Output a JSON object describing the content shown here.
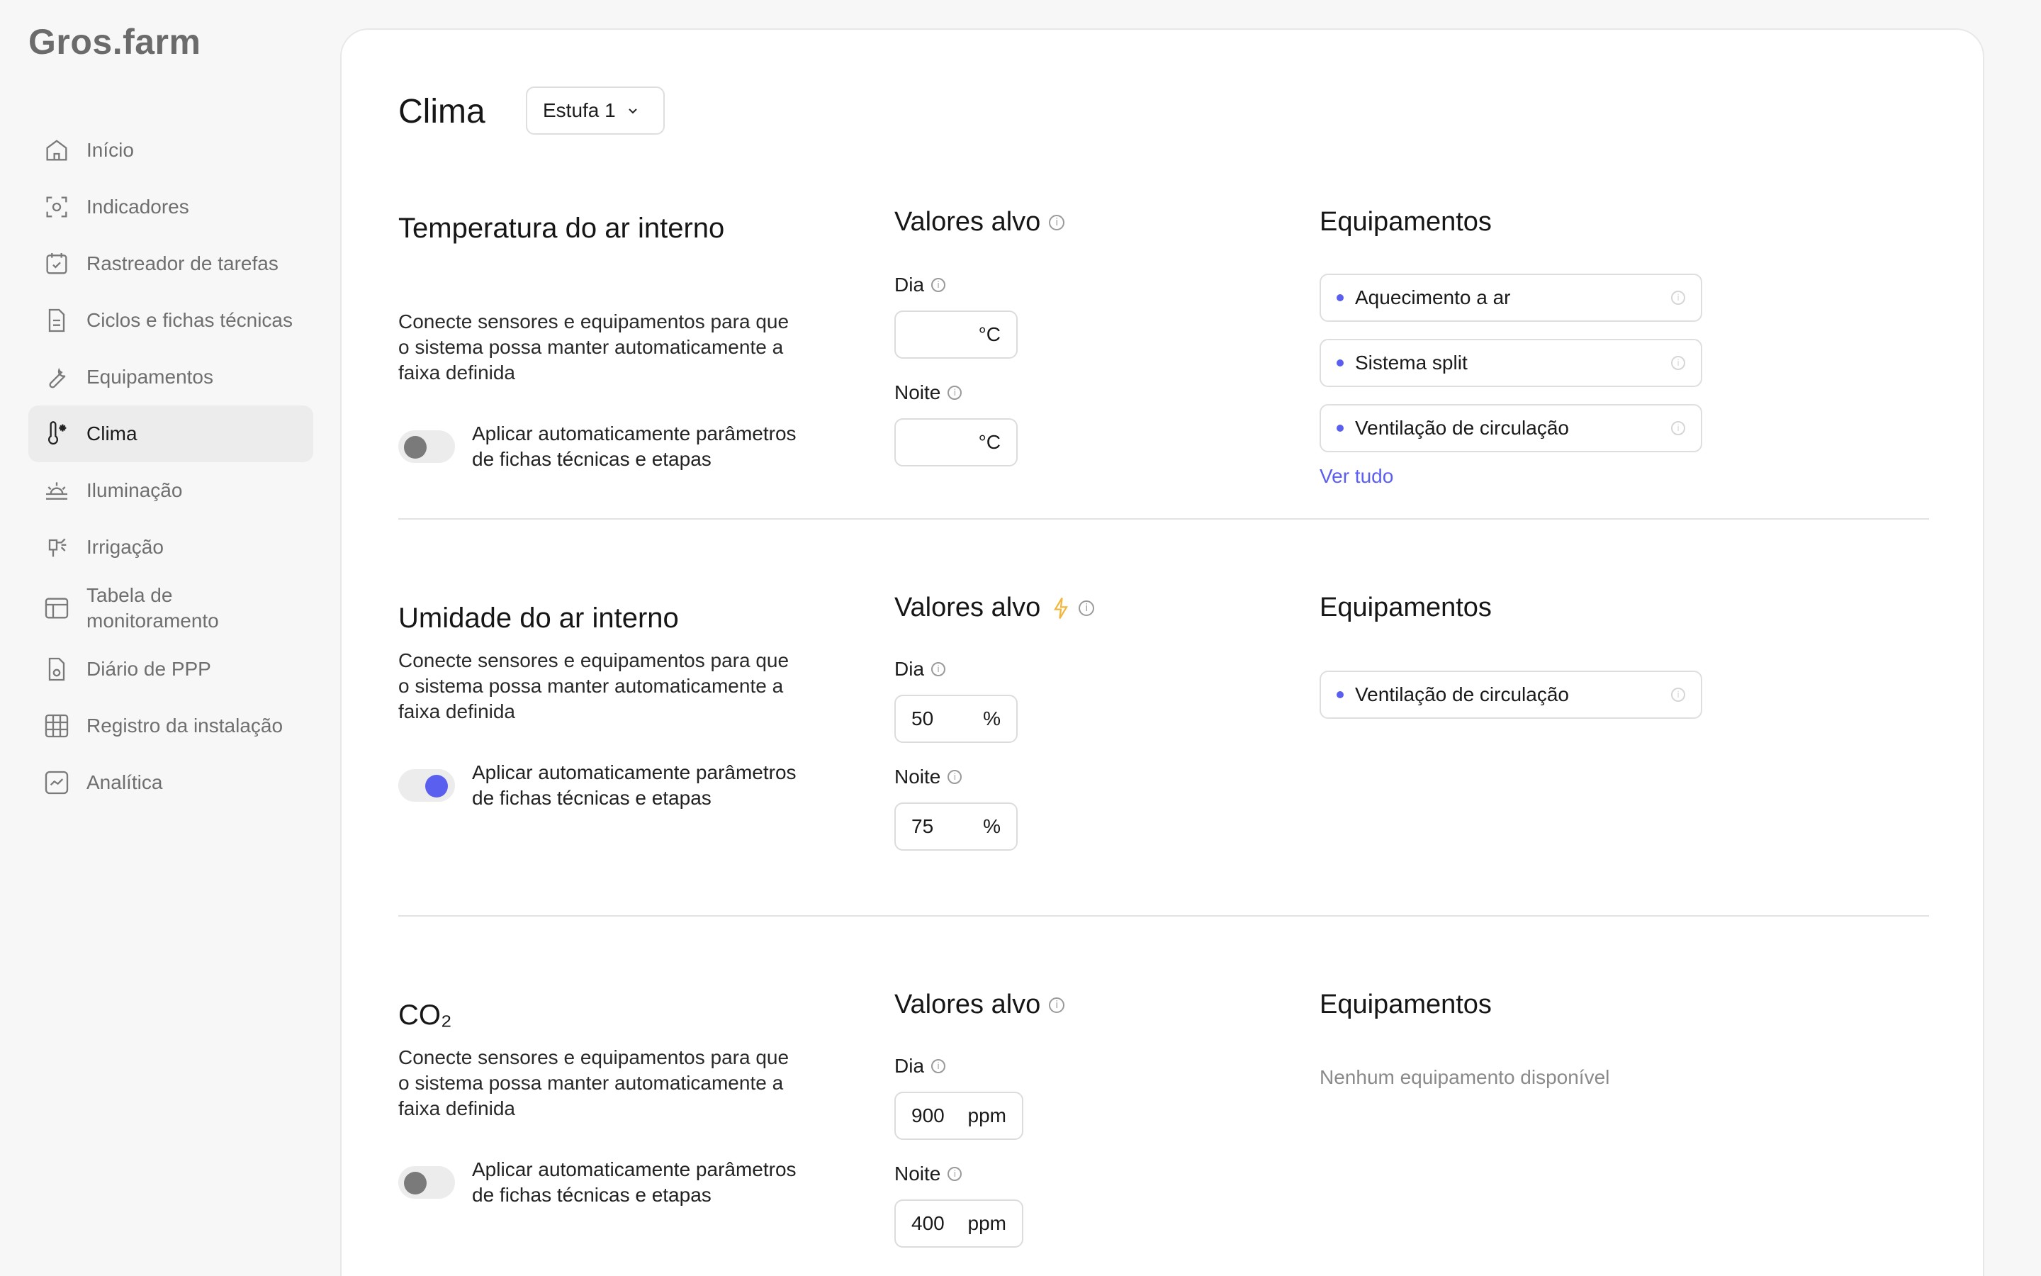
{
  "app": {
    "logo": "Gros.farm"
  },
  "sidebar": {
    "items": [
      {
        "label": "Início",
        "icon": "home-icon"
      },
      {
        "label": "Indicadores",
        "icon": "sensor-icon"
      },
      {
        "label": "Rastreador de tarefas",
        "icon": "calendar-check-icon"
      },
      {
        "label": "Ciclos e fichas técnicas",
        "icon": "document-icon"
      },
      {
        "label": "Equipamentos",
        "icon": "wrench-icon"
      },
      {
        "label": "Clima",
        "icon": "thermometer-icon",
        "active": true
      },
      {
        "label": "Iluminação",
        "icon": "sunrise-icon"
      },
      {
        "label": "Irrigação",
        "icon": "sprinkler-icon"
      },
      {
        "label": "Tabela de monitoramento",
        "icon": "table-icon"
      },
      {
        "label": "Diário de PPP",
        "icon": "ppp-doc-icon"
      },
      {
        "label": "Registro da instalação",
        "icon": "grid-icon"
      },
      {
        "label": "Analítica",
        "icon": "chart-icon"
      }
    ]
  },
  "header": {
    "title": "Clima",
    "select_value": "Estufa 1"
  },
  "sections": [
    {
      "title": "Temperatura do ar interno",
      "desc": "Conecte sensores e equipamentos para que o sistema possa manter automaticamente a faixa definida",
      "toggle_label": "Aplicar automaticamente parâmetros de fichas técnicas e etapas",
      "toggle_on": false,
      "targets_title": "Valores alvo",
      "day_label": "Dia",
      "day_value": "",
      "day_unit": "°C",
      "night_label": "Noite",
      "night_value": "",
      "night_unit": "°C",
      "equip_title": "Equipamentos",
      "equipment": [
        "Aquecimento a ar",
        "Sistema split",
        "Ventilação de circulação"
      ],
      "view_all": "Ver tudo"
    },
    {
      "title": "Umidade do ar interno",
      "desc": "Conecte sensores e equipamentos para que o sistema possa manter automaticamente a faixa definida",
      "toggle_label": "Aplicar automaticamente parâmetros de fichas técnicas e etapas",
      "toggle_on": true,
      "targets_title": "Valores alvo",
      "day_label": "Dia",
      "day_value": "50",
      "day_unit": "%",
      "night_label": "Noite",
      "night_value": "75",
      "night_unit": "%",
      "equip_title": "Equipamentos",
      "equipment": [
        "Ventilação de circulação"
      ]
    },
    {
      "title": "CO₂",
      "desc": "Conecte sensores e equipamentos para que o sistema possa manter automaticamente a faixa definida",
      "toggle_label": "Aplicar automaticamente parâmetros de fichas técnicas e etapas",
      "toggle_on": false,
      "targets_title": "Valores alvo",
      "day_label": "Dia",
      "day_value": "900",
      "day_unit": "ppm",
      "night_label": "Noite",
      "night_value": "400",
      "night_unit": "ppm",
      "equip_title": "Equipamentos",
      "empty_text": "Nenhum equipamento disponível"
    }
  ],
  "colors": {
    "accent": "#5b5ff0",
    "bolt": "#f2b63c"
  }
}
